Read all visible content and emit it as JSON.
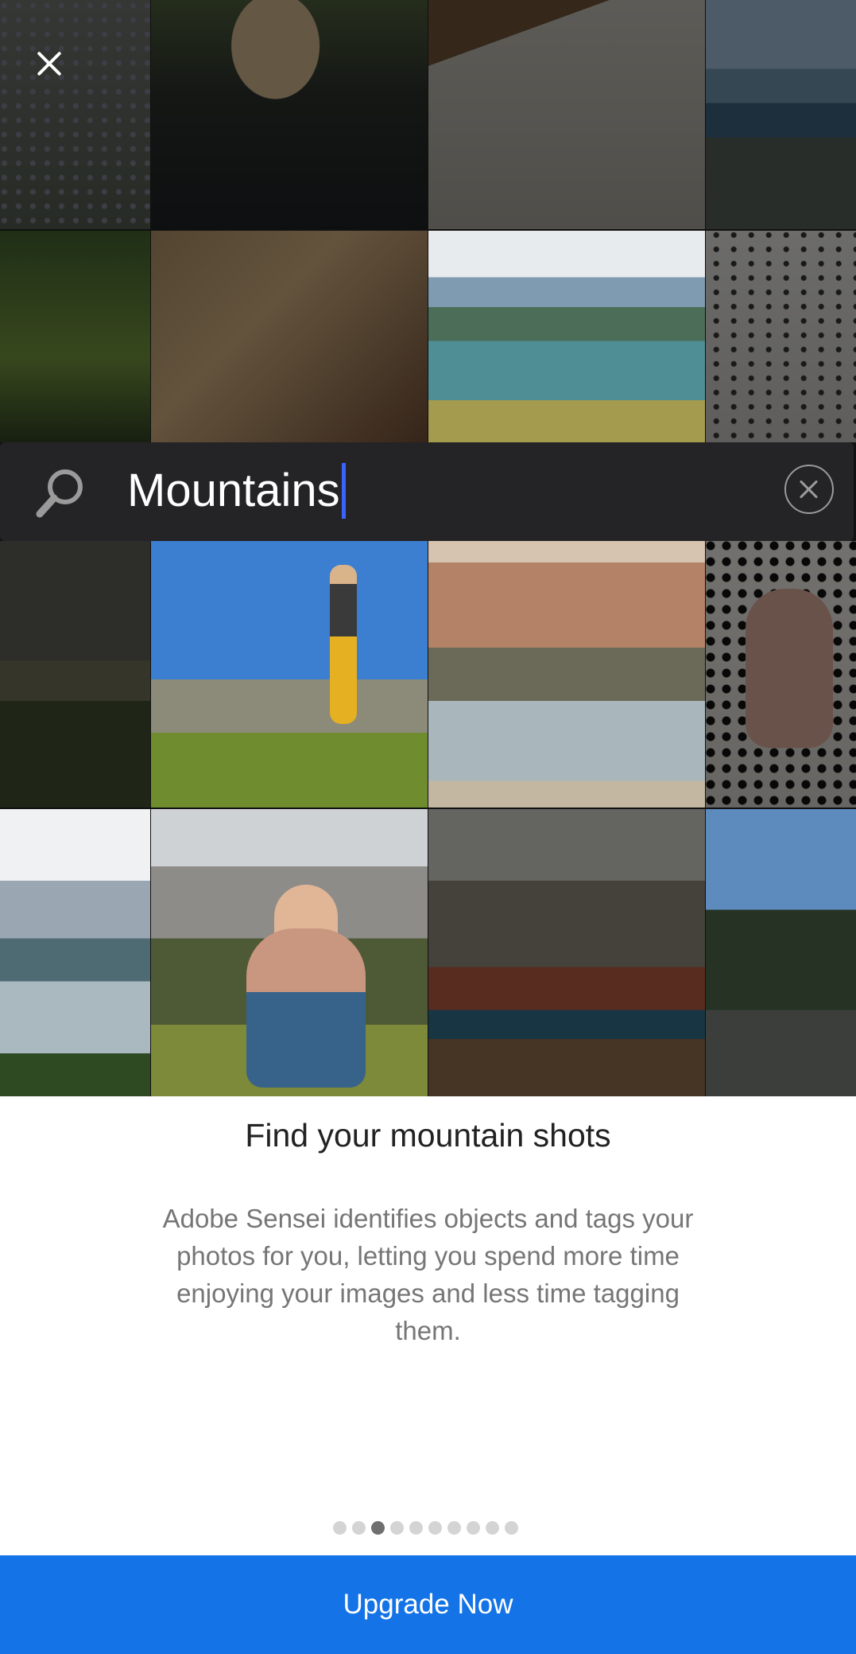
{
  "header": {
    "close_icon": "close-icon"
  },
  "search": {
    "query": "Mountains",
    "search_icon": "search-icon",
    "clear_icon": "clear-circle-icon",
    "caret_color": "#3b63ff"
  },
  "onboarding": {
    "headline": "Find your mountain shots",
    "body": "Adobe Sensei identifies objects and tags your photos for you, letting you spend more time enjoying your images and less time tagging them."
  },
  "pagination": {
    "total": 10,
    "active_index": 3
  },
  "cta": {
    "label": "Upgrade Now",
    "color": "#1473e6"
  },
  "photo_grid": {
    "dimmed_rows_above": [
      [
        "flowers",
        "jacket",
        "sketchbook",
        "cliff-lake"
      ],
      [
        "hiker-dog",
        "map-hands",
        "mountain-lake",
        "birds"
      ]
    ],
    "highlighted_rows_below": [
      [
        "car-field",
        "jumping-hiker",
        "canyon-river",
        "hand-rock"
      ],
      [
        "fjord",
        "hiker-selfie",
        "dog-in-car",
        "campsite"
      ]
    ]
  }
}
